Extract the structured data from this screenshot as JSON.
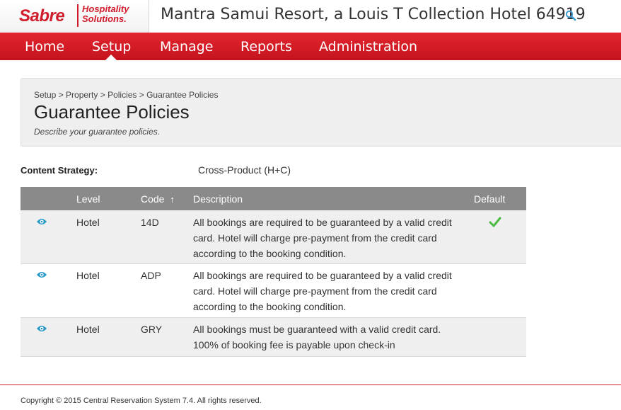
{
  "brand": {
    "name": "Sabre",
    "subtitle_line1": "Hospitality",
    "subtitle_line2": "Solutions."
  },
  "header": {
    "title": "Mantra Samui Resort, a Louis T Collection Hotel 64919",
    "search_icon": "search-icon"
  },
  "nav": {
    "items": [
      {
        "label": "Home"
      },
      {
        "label": "Setup"
      },
      {
        "label": "Manage"
      },
      {
        "label": "Reports"
      },
      {
        "label": "Administration"
      }
    ],
    "active": "Setup"
  },
  "page": {
    "breadcrumb": "Setup > Property > Policies > Guarantee Policies",
    "title": "Guarantee Policies",
    "description": "Describe your guarantee policies."
  },
  "content_strategy": {
    "label": "Content Strategy:",
    "value": "Cross-Product (H+C)"
  },
  "table": {
    "columns": {
      "level": "Level",
      "code": "Code",
      "sort_indicator": "↑",
      "description": "Description",
      "default": "Default"
    },
    "rows": [
      {
        "level": "Hotel",
        "code": "14D",
        "description": "All bookings are required to be guaranteed by a valid credit card. Hotel will charge pre-payment from the credit card according to the booking condition.",
        "is_default": true
      },
      {
        "level": "Hotel",
        "code": "ADP",
        "description": "All bookings are required to be guaranteed by a valid credit card. Hotel will charge pre-payment from the credit card according to the booking condition.",
        "is_default": false
      },
      {
        "level": "Hotel",
        "code": "GRY",
        "description": "All bookings must be guaranteed with a valid credit card. 100% of booking fee is payable upon check-in",
        "is_default": false
      }
    ]
  },
  "footer": {
    "copyright": "Copyright © 2015 Central Reservation System 7.4. All rights reserved."
  },
  "colors": {
    "brand_red": "#d01c2b",
    "nav_red": "#e3262f",
    "table_header": "#8a8a8a",
    "eye_icon": "#2a9ac9",
    "check_icon": "#4cbb44"
  }
}
